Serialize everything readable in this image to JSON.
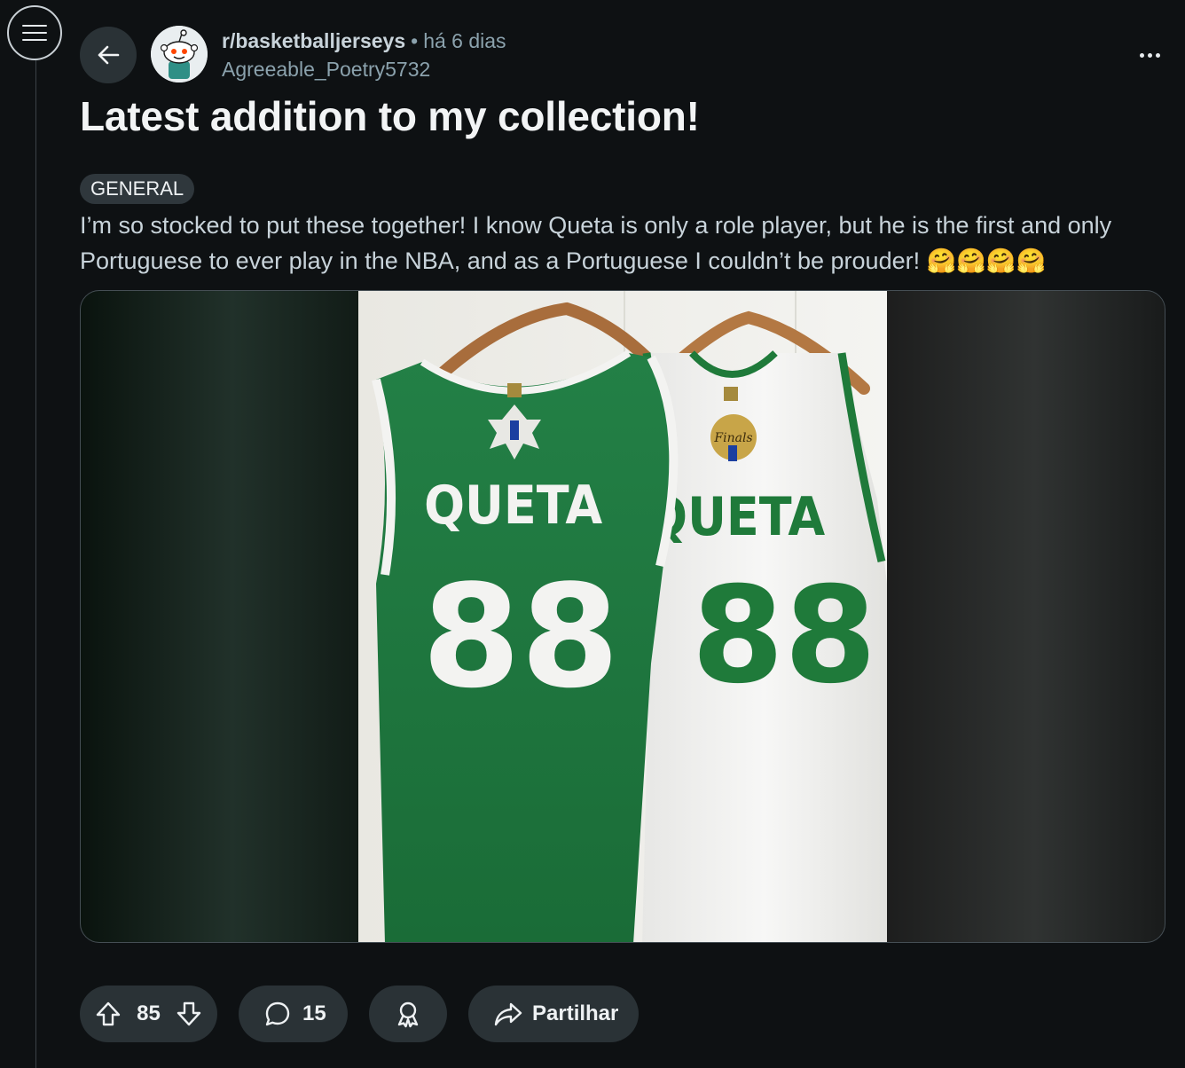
{
  "nav": {
    "menu_icon": "hamburger-menu-icon",
    "back_icon": "arrow-left-icon"
  },
  "post": {
    "subreddit": "r/basketballjerseys",
    "separator": "•",
    "time_ago": "há 6 dias",
    "author": "Agreeable_Poetry5732",
    "more_icon": "more-horizontal-icon",
    "title": "Latest addition to my collection!",
    "flair": "GENERAL",
    "body": "I’m so stocked to put these together! I know Queta is only a role player, but he is the first and only Portuguese to ever play in the NBA, and as a Portuguese I couldn’t be prouder! 🤗🤗🤗🤗",
    "media": {
      "green_jersey_name": "QUETA",
      "green_jersey_number": "88",
      "white_jersey_name": "QUETA",
      "white_jersey_number": "88",
      "finals_patch_text": "Finals"
    }
  },
  "actions": {
    "upvote_icon": "arrow-up-icon",
    "score": "85",
    "downvote_icon": "arrow-down-icon",
    "comment_icon": "speech-bubble-icon",
    "comments": "15",
    "award_icon": "award-icon",
    "share_icon": "share-arrow-icon",
    "share_label": "Partilhar"
  },
  "colors": {
    "background": "#0e1113",
    "button_bg": "#2a3236",
    "muted_text": "#8ba2ad",
    "celtics_green": "#1f7a3a",
    "jersey_white": "#f3f3f1"
  }
}
